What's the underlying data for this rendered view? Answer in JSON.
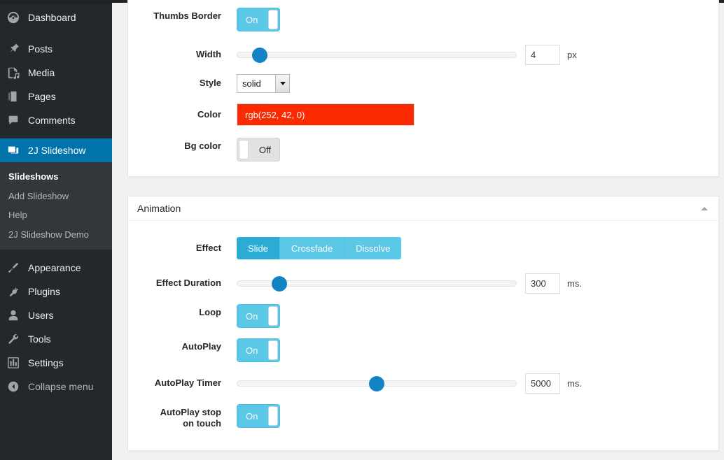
{
  "sidebar": {
    "items": [
      {
        "label": "Dashboard",
        "icon": "dashboard-icon",
        "name": "sidebar-item-dashboard",
        "current": false
      },
      {
        "label": "Posts",
        "icon": "pin-icon",
        "name": "sidebar-item-posts",
        "current": false
      },
      {
        "label": "Media",
        "icon": "media-icon",
        "name": "sidebar-item-media",
        "current": false
      },
      {
        "label": "Pages",
        "icon": "pages-icon",
        "name": "sidebar-item-pages",
        "current": false
      },
      {
        "label": "Comments",
        "icon": "comments-icon",
        "name": "sidebar-item-comments",
        "current": false
      },
      {
        "label": "2J Slideshow",
        "icon": "slideshow-icon",
        "name": "sidebar-item-2j-slideshow",
        "current": true
      }
    ],
    "submenu": [
      {
        "label": "Slideshows",
        "name": "submenu-item-slideshows",
        "current": true
      },
      {
        "label": "Add Slideshow",
        "name": "submenu-item-add-slideshow",
        "current": false
      },
      {
        "label": "Help",
        "name": "submenu-item-help",
        "current": false
      },
      {
        "label": "2J Slideshow Demo",
        "name": "submenu-item-demo",
        "current": false
      }
    ],
    "items_lower": [
      {
        "label": "Appearance",
        "icon": "appearance-icon",
        "name": "sidebar-item-appearance"
      },
      {
        "label": "Plugins",
        "icon": "plugins-icon",
        "name": "sidebar-item-plugins"
      },
      {
        "label": "Users",
        "icon": "users-icon",
        "name": "sidebar-item-users"
      },
      {
        "label": "Tools",
        "icon": "tools-icon",
        "name": "sidebar-item-tools"
      },
      {
        "label": "Settings",
        "icon": "settings-icon",
        "name": "sidebar-item-settings"
      }
    ],
    "collapse": {
      "label": "Collapse menu",
      "icon": "collapse-arrow-icon",
      "name": "collapse-menu-button"
    }
  },
  "thumbs_panel": {
    "rows": {
      "thumbs_border": {
        "label": "Thumbs Border",
        "state": "On"
      },
      "width": {
        "label": "Width",
        "value": "4",
        "unit": "px",
        "handle_pct": 8
      },
      "style": {
        "label": "Style",
        "value": "solid"
      },
      "color": {
        "label": "Color",
        "value": "rgb(252, 42, 0)",
        "swatch": "#fc2a00"
      },
      "bg_color": {
        "label": "Bg color",
        "state": "Off"
      }
    }
  },
  "animation_panel": {
    "title": "Animation",
    "rows": {
      "effect": {
        "label": "Effect",
        "options": [
          "Slide",
          "Crossfade",
          "Dissolve"
        ],
        "selected": "Slide"
      },
      "effect_duration": {
        "label": "Effect Duration",
        "value": "300",
        "unit": "ms.",
        "handle_pct": 15
      },
      "loop": {
        "label": "Loop",
        "state": "On"
      },
      "autoplay": {
        "label": "AutoPlay",
        "state": "On"
      },
      "autoplay_timer": {
        "label": "AutoPlay Timer",
        "value": "5000",
        "unit": "ms.",
        "handle_pct": 50
      },
      "autoplay_stop": {
        "label": "AutoPlay stop on touch",
        "label_line1": "AutoPlay stop",
        "label_line2": "on touch",
        "state": "On"
      }
    }
  },
  "colors": {
    "sidebar_bg": "#23282d",
    "submenu_bg": "#32373c",
    "accent_blue": "#0073aa",
    "toggle_on": "#5bc8e8",
    "slider_handle": "#1383c6",
    "seg_active": "#2bacd4",
    "color_swatch": "#fc2a00"
  }
}
